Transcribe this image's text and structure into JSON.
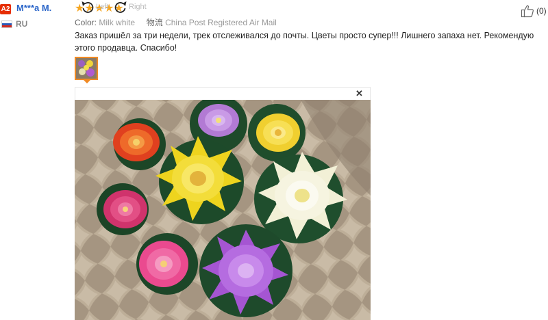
{
  "reviewer": {
    "level": "A2",
    "name": "M***a M.",
    "country_code": "RU"
  },
  "rating": {
    "stars": 5,
    "stars_text": "★★★★★",
    "color": "#f5a623"
  },
  "attributes": {
    "color_label": "Color:",
    "color_value": "Milk white",
    "logistics_label": "物流",
    "logistics_value": "China Post Registered Air Mail"
  },
  "helpful": {
    "count_text": "(0)"
  },
  "review": {
    "text": "Заказ пришёл за три недели, трек отслеживался до почты. Цветы просто супер!!! Лишнего запаха нет. Рекомендую этого продавца. Спасибо!"
  },
  "viewer": {
    "rotate_left_label": "Left",
    "rotate_right_label": "Right",
    "close_symbol": "✕"
  },
  "colors": {
    "accent_orange": "#f08a24",
    "badge_red": "#e62e04",
    "name_blue": "#2a65c9"
  }
}
